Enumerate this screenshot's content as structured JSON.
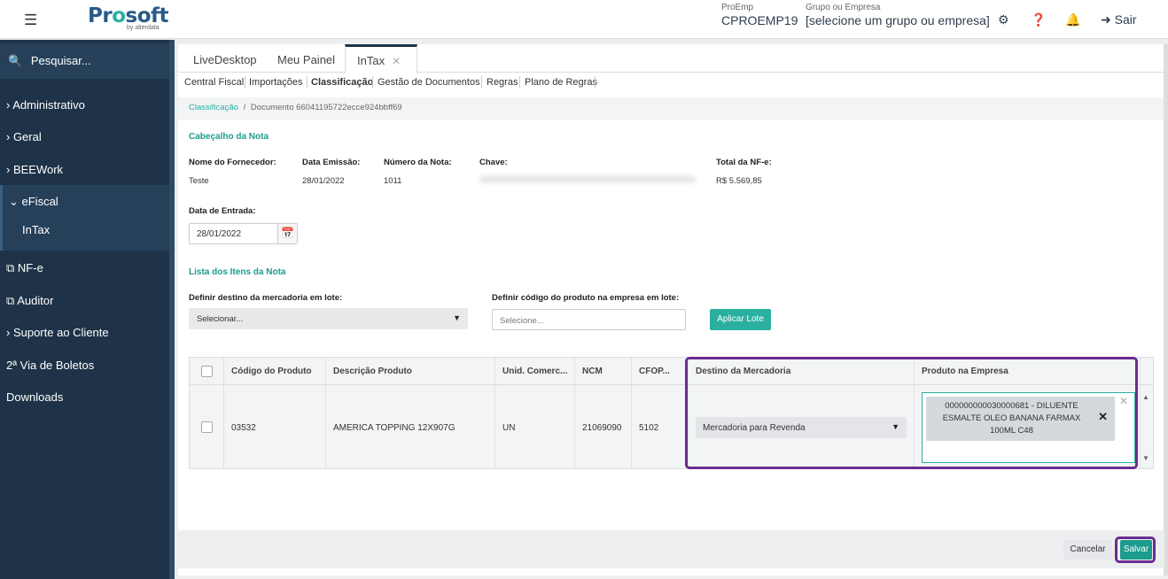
{
  "header": {
    "logo_text_a": "Pr",
    "logo_text_b": "o",
    "logo_text_c": "soft",
    "logo_sub": "by alterdata",
    "proemp_label": "ProEmp",
    "proemp_value": "CPROEMP19",
    "grupo_label": "Grupo ou Empresa",
    "grupo_value": "[selecione um grupo ou empresa]",
    "sair_label": "Sair"
  },
  "sidebar": {
    "search": "Pesquisar...",
    "items": {
      "administrativo": "› Administrativo",
      "geral": "› Geral",
      "beework": "› BEEWork",
      "efiscal": "⌄ eFiscal",
      "intax": "InTax",
      "nfe": "NF-e",
      "auditor": "Auditor",
      "suporte": "› Suporte ao Cliente",
      "boletos": "2ª Via de Boletos",
      "downloads": "Downloads"
    }
  },
  "tabs": {
    "livedesktop": "LiveDesktop",
    "meupainel": "Meu Painel",
    "intax": "InTax"
  },
  "subnav": {
    "central": "Central Fiscal",
    "importacoes": "Importações",
    "classificacao": "Classificação",
    "gestao": "Gestão de Documentos",
    "regras": "Regras",
    "plano": "Plano de Regras"
  },
  "breadcrumb": {
    "link": "Classificação",
    "sep": "/",
    "current": "Documento 66041195722ecce924bbff69"
  },
  "cabecalho": {
    "title": "Cabeçalho da Nota",
    "fornecedor_label": "Nome do Fornecedor:",
    "fornecedor_value": "Teste",
    "emissao_label": "Data Emissão:",
    "emissao_value": "28/01/2022",
    "numero_label": "Número da Nota:",
    "numero_value": "1011",
    "chave_label": "Chave:",
    "total_label": "Total da NF-e:",
    "total_value": "R$ 5.569,85",
    "entrada_label": "Data de Entrada:",
    "entrada_value": "28/01/2022"
  },
  "lista": {
    "title": "Lista dos Itens da Nota",
    "destino_lote_label": "Definir destino da mercadoria em lote:",
    "destino_lote_value": "Selecionar...",
    "codigo_lote_label": "Definir código do produto na empresa em lote:",
    "codigo_lote_placeholder": "Selecione...",
    "aplicar_label": "Aplicar Lote"
  },
  "table": {
    "headers": {
      "codigo": "Código do Produto",
      "descricao": "Descrição Produto",
      "unid": "Unid. Comerc...",
      "ncm": "NCM",
      "cfop": "CFOP...",
      "destino": "Destino da Mercadoria",
      "produto": "Produto na Empresa"
    },
    "row": {
      "codigo": "03532",
      "descricao": "AMERICA TOPPING 12X907G",
      "unid": "UN",
      "ncm": "21069090",
      "cfop": "5102",
      "destino": "Mercadoria para Revenda",
      "produto": "000000000030000681 - DILUENTE ESMALTE OLEO BANANA FARMAX 100ML C48"
    }
  },
  "footer": {
    "cancel_label": "Cancelar",
    "save_label": "Salvar"
  },
  "colors": {
    "sidebar_bg": "#1e3348",
    "accent": "#2bb0a0",
    "highlight": "#6b2c91"
  }
}
